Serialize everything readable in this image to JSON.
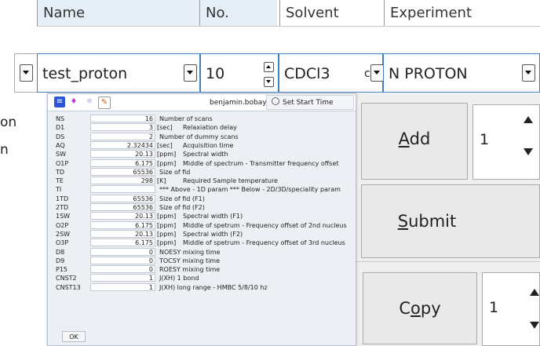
{
  "columns": {
    "name": "Name",
    "no": "No.",
    "solvent": "Solvent",
    "experiment": "Experiment"
  },
  "experiment_row": {
    "name": "test_proton",
    "number": "10",
    "solvent": "CDCl3",
    "solvent_overflow": "c",
    "experiment": "N PROTON"
  },
  "left_clipped": [
    "on",
    "n"
  ],
  "dialog": {
    "username": "benjamin.bobay",
    "set_start_time_label": "Set Start Time",
    "ok_label": "OK",
    "toolbar_icons": [
      "list-icon",
      "flask-icon",
      "molecule-icon",
      "edit-icon"
    ],
    "params": [
      {
        "name": "NS",
        "value": "16",
        "unit": "",
        "desc": "Number of scans"
      },
      {
        "name": "D1",
        "value": "3",
        "unit": "[sec]",
        "desc": "Relaxiation delay"
      },
      {
        "name": "DS",
        "value": "2",
        "unit": "",
        "desc": "Number of dummy scans"
      },
      {
        "name": "AQ",
        "value": "2.32434",
        "unit": "[sec]",
        "desc": "Acquisition time"
      },
      {
        "name": "SW",
        "value": "20.13",
        "unit": "[ppm]",
        "desc": "Spectral width"
      },
      {
        "name": "O1P",
        "value": "6.175",
        "unit": "[ppm]",
        "desc": "Middle of spectrum - Transmitter frequency offset"
      },
      {
        "name": "TD",
        "value": "65536",
        "unit": "",
        "desc": "Size of fid"
      },
      {
        "name": "TE",
        "value": "298",
        "unit": "[K]",
        "desc": "Required Sample temperature"
      },
      {
        "name": "TI",
        "value": "",
        "unit": "",
        "desc": "*** Above - 1D param *** Below - 2D/3D/speciality param"
      },
      {
        "name": "1TD",
        "value": "65536",
        "unit": "",
        "desc": "Size of fid (F1)"
      },
      {
        "name": "2TD",
        "value": "65536",
        "unit": "",
        "desc": "Size of fid (F2)"
      },
      {
        "name": "1SW",
        "value": "20.13",
        "unit": "[ppm]",
        "desc": "Spectral width (F1)"
      },
      {
        "name": "O2P",
        "value": "6.175",
        "unit": "[ppm]",
        "desc": "Middle of spetrum - Frequency offset of 2nd nucleus"
      },
      {
        "name": "2SW",
        "value": "20.13",
        "unit": "[ppm]",
        "desc": "Spectral width (F2)"
      },
      {
        "name": "O3P",
        "value": "6.175",
        "unit": "[ppm]",
        "desc": "Middle of spetrum - Frequency offset of 3rd nucleus"
      },
      {
        "name": "D8",
        "value": "0",
        "unit": "",
        "desc": "NOESY mixing time"
      },
      {
        "name": "D9",
        "value": "0",
        "unit": "",
        "desc": "TOCSY mixing time"
      },
      {
        "name": "P15",
        "value": "0",
        "unit": "",
        "desc": "ROESY mixing time"
      },
      {
        "name": "CNST2",
        "value": "1",
        "unit": "",
        "desc": "J(XH) 1 bond"
      },
      {
        "name": "CNST13",
        "value": "1",
        "unit": "",
        "desc": "J(XH) long range - HMBC 5/8/10 hz"
      }
    ]
  },
  "actions": {
    "add_label": "Add",
    "add_mnemonic": "A",
    "add_rest": "dd",
    "add_count": "1",
    "submit_label": "Submit",
    "submit_mnemonic": "S",
    "submit_rest": "ubmit",
    "copy_label": "Copy",
    "copy_pre": "C",
    "copy_mnemonic": "o",
    "copy_rest": "py",
    "copy_count": "1"
  },
  "colors": {
    "accent": "#3f7fc4",
    "toolbar_active": "#2a55d8"
  }
}
